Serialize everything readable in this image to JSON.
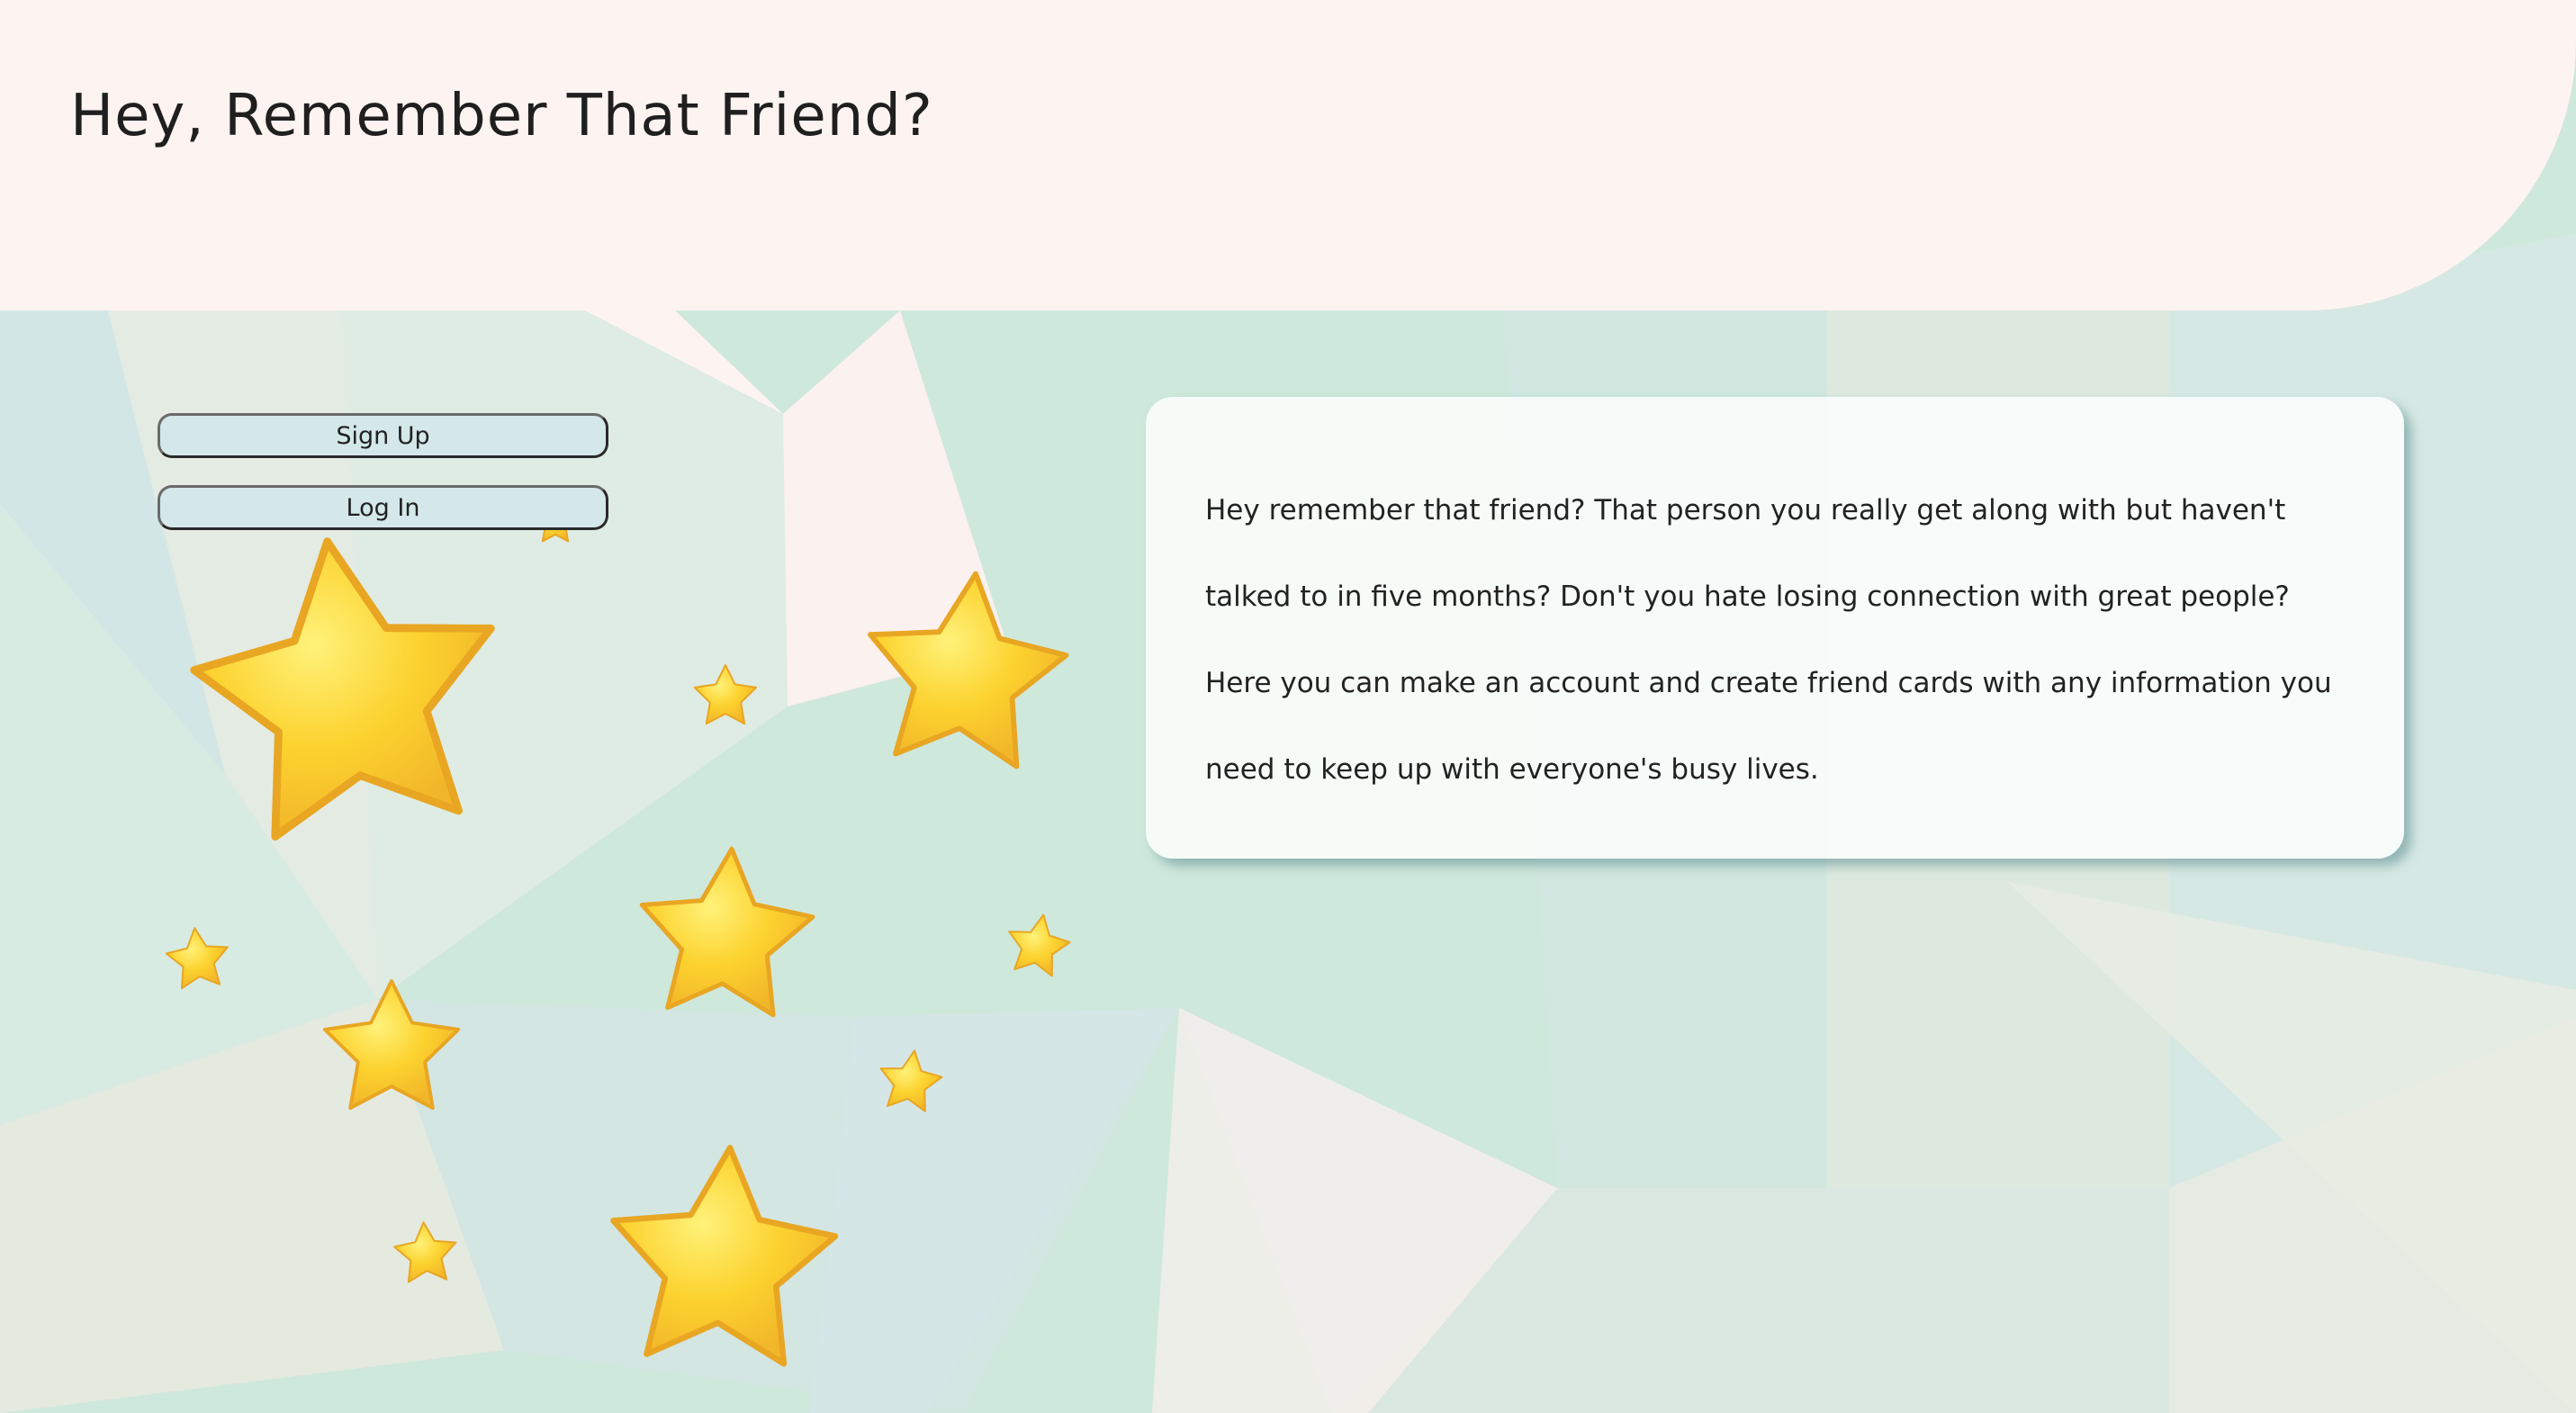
{
  "header": {
    "title": "Hey, Remember That Friend?"
  },
  "auth": {
    "signup_label": "Sign Up",
    "login_label": "Log In"
  },
  "intro": {
    "text": "Hey remember that friend? That person you really get along with but haven't talked to in five months? Don't you hate losing connection with great people? Here you can make an account and create friend cards with any information you need to keep up with everyone's busy lives."
  },
  "decor": {
    "icon": "star-icon",
    "star_color": "#fcd22e",
    "star_outline": "#e8a623",
    "background_palette": [
      "#cfe8dc",
      "#d4e8e6",
      "#e6ece2",
      "#fdf4f1",
      "#d3e6ea"
    ]
  }
}
